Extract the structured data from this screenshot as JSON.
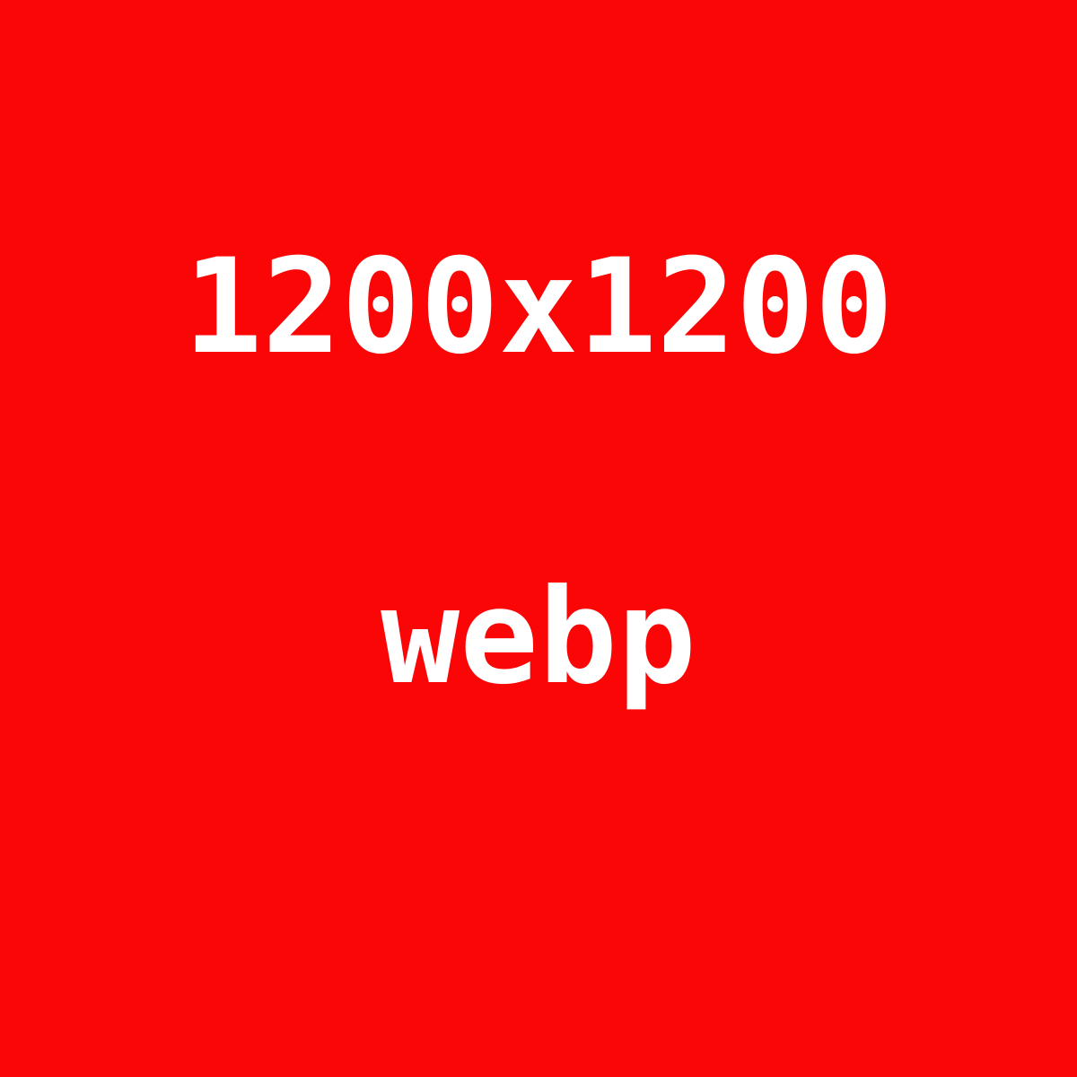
{
  "image": {
    "dimensions_label": "1200x1200",
    "format_label": "webp",
    "background_color": "#fa0606",
    "text_color": "#ffffff"
  }
}
